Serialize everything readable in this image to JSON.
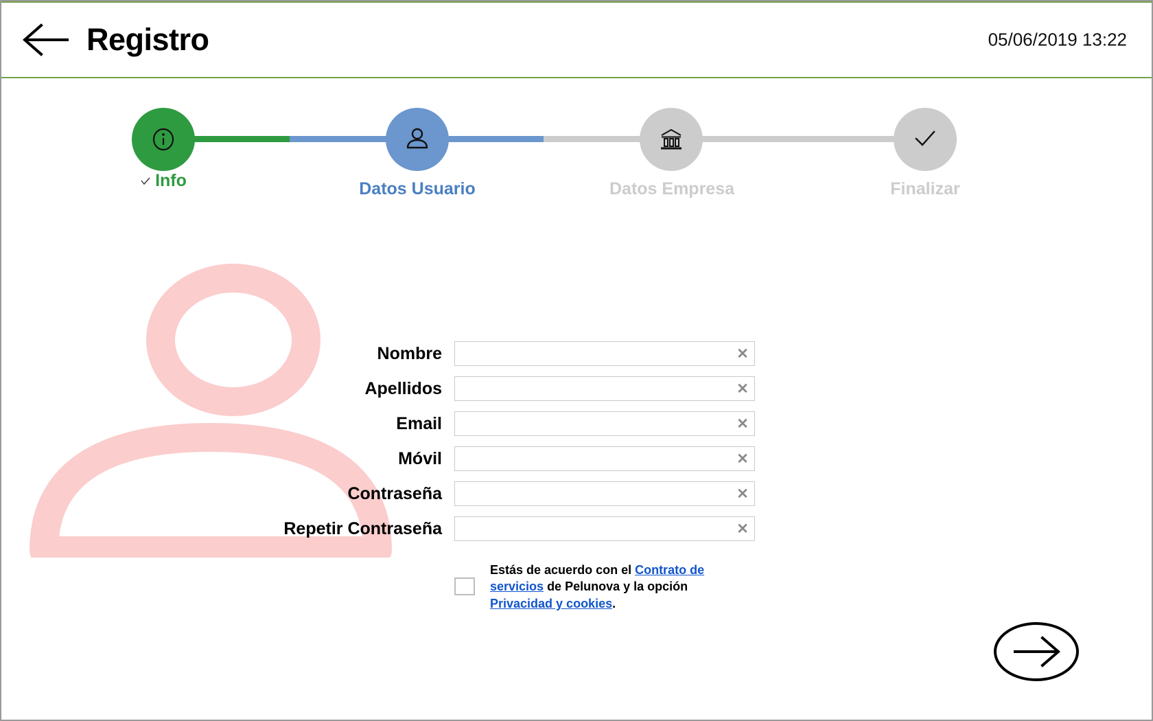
{
  "header": {
    "back_icon": "arrow-left-icon",
    "title": "Registro",
    "datetime": "05/06/2019 13:22",
    "border_color": "#76a34b"
  },
  "stepper": {
    "steps": [
      {
        "label": "Info",
        "icon": "info-icon",
        "state": "completed",
        "color": "#2e9b41"
      },
      {
        "label": "Datos Usuario",
        "icon": "person-icon",
        "state": "active",
        "color": "#6b96ce"
      },
      {
        "label": "Datos Empresa",
        "icon": "bank-icon",
        "state": "pending",
        "color": "#cccccc"
      },
      {
        "label": "Finalizar",
        "icon": "check-icon",
        "state": "pending",
        "color": "#cccccc"
      }
    ],
    "connectors": [
      {
        "left_color": "#2e9b41",
        "right_color": "#6b96ce"
      },
      {
        "left_color": "#6b96ce",
        "right_color": "#cccccc"
      },
      {
        "left_color": "#cccccc",
        "right_color": "#cccccc"
      }
    ]
  },
  "watermark": {
    "icon": "person-watermark-icon",
    "color": "#fbcdcd"
  },
  "form": {
    "fields": [
      {
        "label": "Nombre",
        "value": "",
        "placeholder": "",
        "type": "text",
        "clear_icon": "clear-x-icon"
      },
      {
        "label": "Apellidos",
        "value": "",
        "placeholder": "",
        "type": "text",
        "clear_icon": "clear-x-icon"
      },
      {
        "label": "Email",
        "value": "",
        "placeholder": "",
        "type": "text",
        "clear_icon": "clear-x-icon"
      },
      {
        "label": "Móvil",
        "value": "",
        "placeholder": "",
        "type": "text",
        "clear_icon": "clear-x-icon"
      },
      {
        "label": "Contraseña",
        "value": "",
        "placeholder": "",
        "type": "password",
        "clear_icon": "clear-x-icon"
      },
      {
        "label": "Repetir Contraseña",
        "value": "",
        "placeholder": "",
        "type": "password",
        "clear_icon": "clear-x-icon"
      }
    ],
    "terms": {
      "checked": false,
      "part1": "Estás de acuerdo con el ",
      "link1": "Contrato de servicios",
      "part2": " de Pelunova y la opción ",
      "link2": "Privacidad y cookies",
      "part3": ".",
      "link_color": "#1155cc"
    }
  },
  "footer": {
    "next_icon": "arrow-right-circle-icon"
  }
}
